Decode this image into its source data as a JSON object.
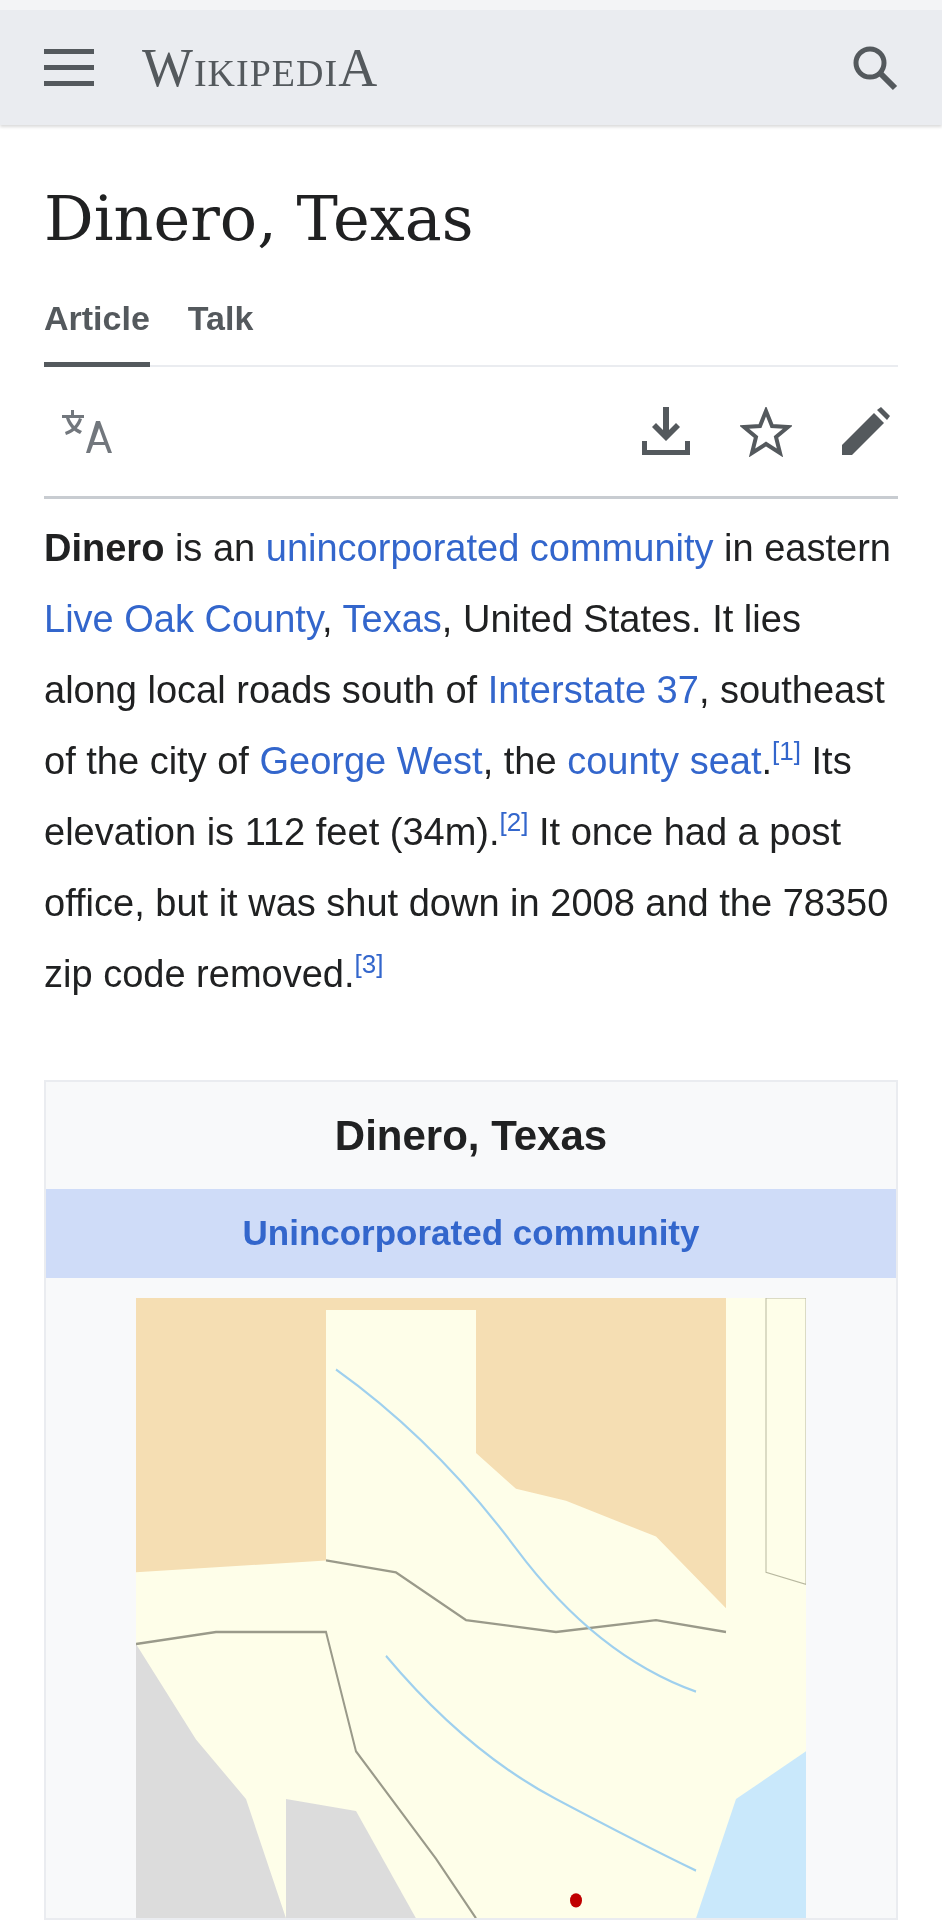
{
  "header": {
    "logo": "WikipediA"
  },
  "title": "Dinero, Texas",
  "tabs": [
    {
      "label": "Article",
      "selected": true
    },
    {
      "label": "Talk",
      "selected": false
    }
  ],
  "paragraph": [
    {
      "kind": "bold",
      "text": "Dinero"
    },
    {
      "kind": "text",
      "text": " is an "
    },
    {
      "kind": "link",
      "text": "unincorporated community"
    },
    {
      "kind": "text",
      "text": " in eastern "
    },
    {
      "kind": "link",
      "text": "Live Oak County"
    },
    {
      "kind": "text",
      "text": ", "
    },
    {
      "kind": "link",
      "text": "Texas"
    },
    {
      "kind": "text",
      "text": ", United States. It lies along local roads south of "
    },
    {
      "kind": "link",
      "text": "Interstate 37"
    },
    {
      "kind": "text",
      "text": ", southeast of the city of "
    },
    {
      "kind": "link",
      "text": "George West"
    },
    {
      "kind": "text",
      "text": ", the "
    },
    {
      "kind": "link",
      "text": "county seat"
    },
    {
      "kind": "text",
      "text": "."
    },
    {
      "kind": "ref",
      "text": "[1]"
    },
    {
      "kind": "text",
      "text": " Its elevation is 112 feet (34m)."
    },
    {
      "kind": "ref",
      "text": "[2]"
    },
    {
      "kind": "text",
      "text": " It once had a post office, but it was shut down in 2008 and the 78350 zip code removed."
    },
    {
      "kind": "ref",
      "text": "[3]"
    }
  ],
  "infobox": {
    "title": "Dinero, Texas",
    "subheader": "Unincorporated community"
  }
}
